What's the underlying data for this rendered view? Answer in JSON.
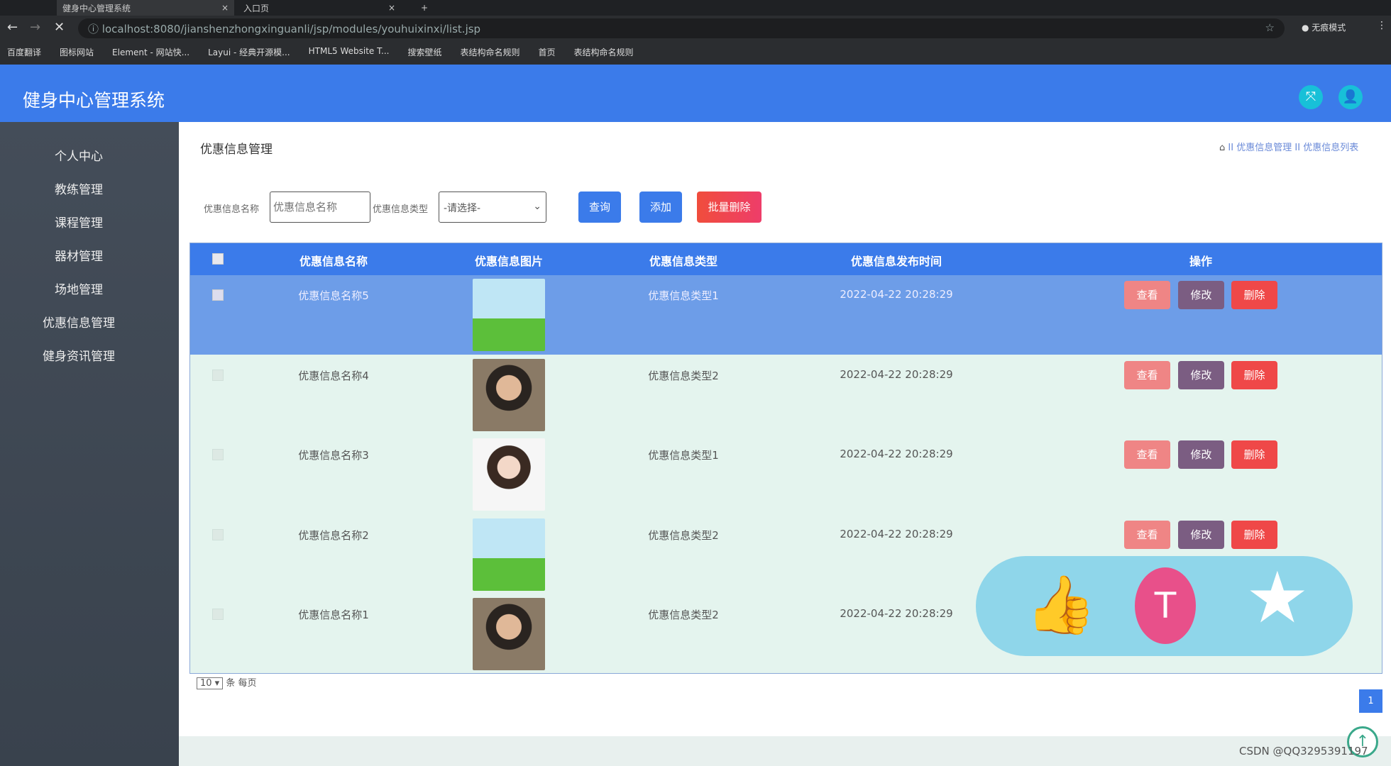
{
  "browser": {
    "tabs": [
      "健身中心管理系统",
      "入口页"
    ],
    "url": "localhost:8080/jianshenzhongxinguanli/jsp/modules/youhuixinxi/list.jsp",
    "incognito": "无痕模式",
    "bookmarks": [
      "百度翻译",
      "图标网站",
      "Element - 网站快...",
      "Layui - 经典开源模...",
      "HTML5 Website T...",
      "搜索壁纸",
      "表结构命名规则",
      "首页",
      "表结构命名规则"
    ]
  },
  "app": {
    "title": "健身中心管理系统"
  },
  "sidebar": {
    "items": [
      "个人中心",
      "教练管理",
      "课程管理",
      "器材管理",
      "场地管理",
      "优惠信息管理",
      "健身资讯管理"
    ]
  },
  "page": {
    "title": "优惠信息管理",
    "breadcrumb": [
      "优惠信息管理",
      "优惠信息列表"
    ],
    "sep": "II"
  },
  "search": {
    "name_label": "优惠信息名称",
    "name_placeholder": "优惠信息名称",
    "type_label": "优惠信息类型",
    "type_value": "-请选择-",
    "query": "查询",
    "add": "添加",
    "batch_delete": "批量删除"
  },
  "table": {
    "headers": [
      "优惠信息名称",
      "优惠信息图片",
      "优惠信息类型",
      "优惠信息发布时间",
      "操作"
    ],
    "rows": [
      {
        "name": "优惠信息名称5",
        "type": "优惠信息类型1",
        "time": "2022-04-22 20:28:29",
        "img": "cartoon"
      },
      {
        "name": "优惠信息名称4",
        "type": "优惠信息类型2",
        "time": "2022-04-22 20:28:29",
        "img": "photo"
      },
      {
        "name": "优惠信息名称3",
        "type": "优惠信息类型1",
        "time": "2022-04-22 20:28:29",
        "img": "girl"
      },
      {
        "name": "优惠信息名称2",
        "type": "优惠信息类型2",
        "time": "2022-04-22 20:28:29",
        "img": "cartoon"
      },
      {
        "name": "优惠信息名称1",
        "type": "优惠信息类型2",
        "time": "2022-04-22 20:28:29",
        "img": "photo"
      }
    ],
    "actions": {
      "view": "查看",
      "edit": "修改",
      "delete": "删除"
    }
  },
  "pagination": {
    "page_size": "10",
    "per_page_label": "条 每页",
    "current_page": "1"
  },
  "watermark": "CSDN @QQ3295391197",
  "colors": {
    "header": "#3b7bea",
    "view": "#ef8585",
    "edit": "#7b5d82",
    "delete": "#ef4848",
    "rows": "#e4f4ee",
    "selected_row": "#6d9de8"
  }
}
